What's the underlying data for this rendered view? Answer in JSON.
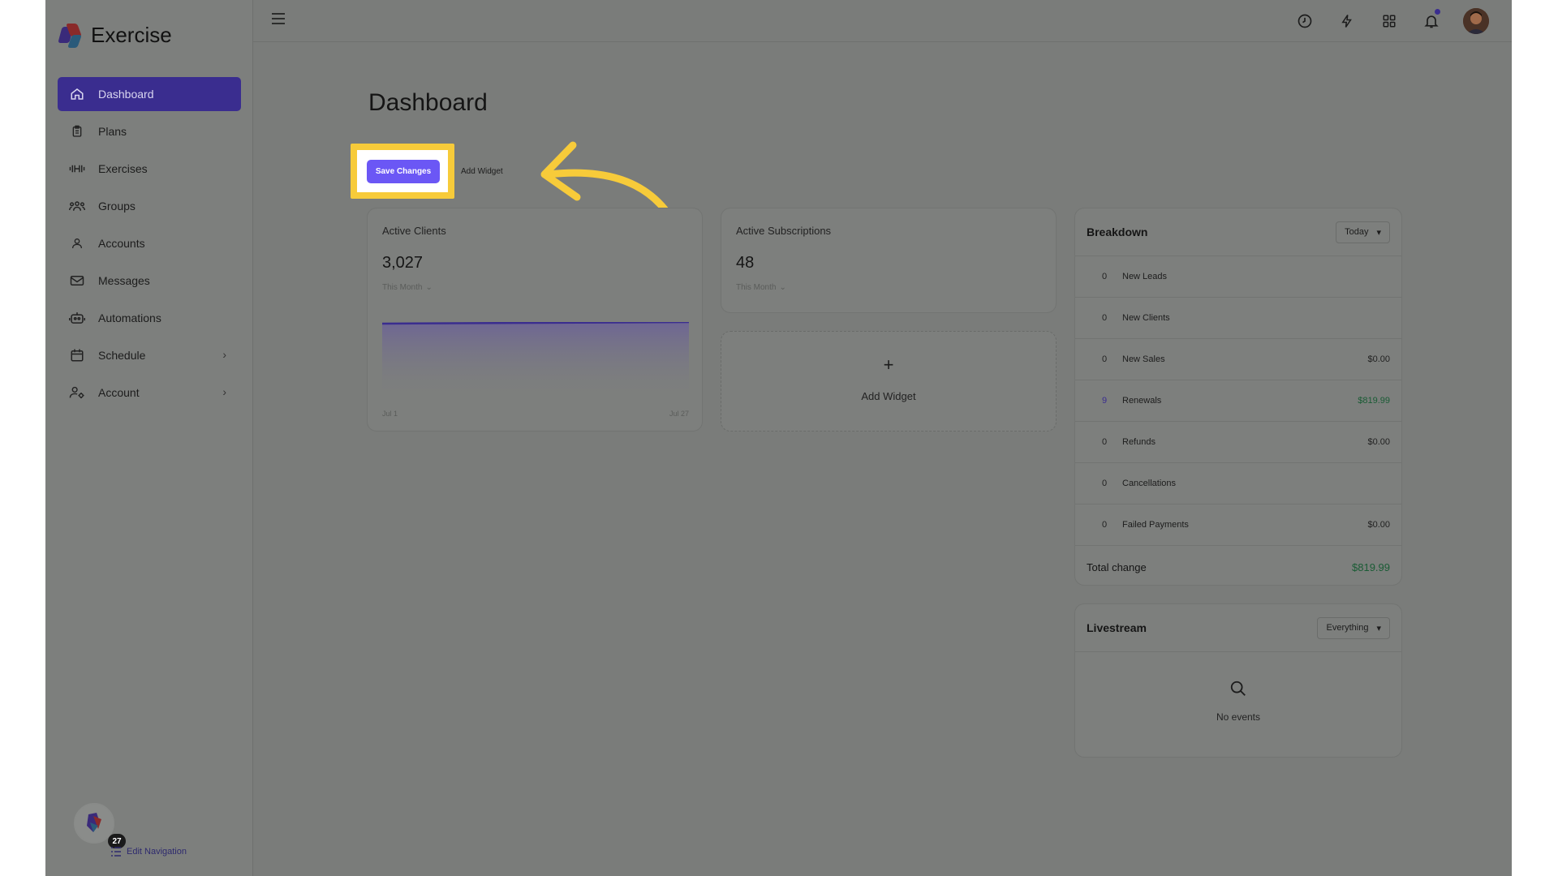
{
  "app": {
    "name": "Exercise"
  },
  "sidebar": {
    "items": [
      {
        "label": "Dashboard",
        "icon": "home-icon",
        "active": true
      },
      {
        "label": "Plans",
        "icon": "clipboard-icon"
      },
      {
        "label": "Exercises",
        "icon": "dumbbell-icon"
      },
      {
        "label": "Groups",
        "icon": "users-icon"
      },
      {
        "label": "Accounts",
        "icon": "user-icon"
      },
      {
        "label": "Messages",
        "icon": "mail-icon"
      },
      {
        "label": "Automations",
        "icon": "robot-icon"
      },
      {
        "label": "Schedule",
        "icon": "calendar-icon",
        "expandable": true
      },
      {
        "label": "Account",
        "icon": "user-settings-icon",
        "expandable": true
      }
    ],
    "badge_count": "27",
    "edit_navigation": "Edit Navigation"
  },
  "topbar": {
    "icons": [
      "clock-icon",
      "bolt-icon",
      "grid-icon",
      "bell-icon"
    ],
    "has_notification": true
  },
  "page": {
    "title": "Dashboard",
    "save_label": "Save Changes",
    "add_widget_label": "Add Widget"
  },
  "cards": {
    "active_clients": {
      "title": "Active Clients",
      "value": "3,027",
      "period": "This Month",
      "x_start": "Jul 1",
      "x_end": "Jul 27"
    },
    "active_subscriptions": {
      "title": "Active Subscriptions",
      "value": "48",
      "period": "This Month"
    },
    "add_widget": {
      "label": "Add Widget"
    }
  },
  "breakdown": {
    "title": "Breakdown",
    "range": "Today",
    "rows": [
      {
        "count": "0",
        "label": "New Leads",
        "amount": ""
      },
      {
        "count": "0",
        "label": "New Clients",
        "amount": ""
      },
      {
        "count": "0",
        "label": "New Sales",
        "amount": "$0.00"
      },
      {
        "count": "9",
        "label": "Renewals",
        "amount": "$819.99",
        "highlight": true
      },
      {
        "count": "0",
        "label": "Refunds",
        "amount": "$0.00"
      },
      {
        "count": "0",
        "label": "Cancellations",
        "amount": ""
      },
      {
        "count": "0",
        "label": "Failed Payments",
        "amount": "$0.00"
      }
    ],
    "total_label": "Total change",
    "total_value": "$819.99"
  },
  "livestream": {
    "title": "Livestream",
    "filter": "Everything",
    "empty_text": "No events"
  },
  "colors": {
    "accent": "#6b57f5",
    "highlight": "#f7cb3a",
    "positive": "#1a5c35"
  }
}
